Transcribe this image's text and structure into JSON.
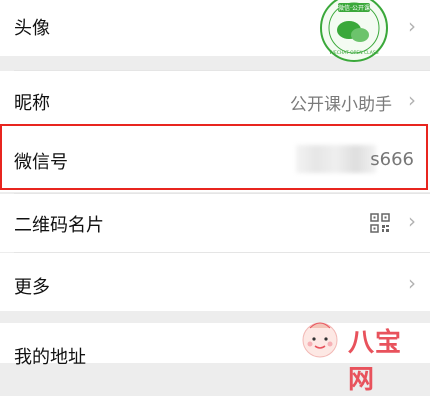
{
  "rows": {
    "avatar": {
      "label": "头像",
      "seal_text": "微信·公开课 WECHAT OPEN CLASS"
    },
    "nickname": {
      "label": "昵称",
      "value": "公开课小助手"
    },
    "wechat_id": {
      "label": "微信号",
      "value": "s666"
    },
    "qrcode": {
      "label": "二维码名片"
    },
    "more": {
      "label": "更多"
    },
    "address": {
      "label": "我的地址"
    }
  },
  "watermark": {
    "text": "八宝网"
  },
  "colors": {
    "highlight": "#e8251f",
    "brand_green": "#3aa83a",
    "watermark_pink": "#e8525c"
  }
}
